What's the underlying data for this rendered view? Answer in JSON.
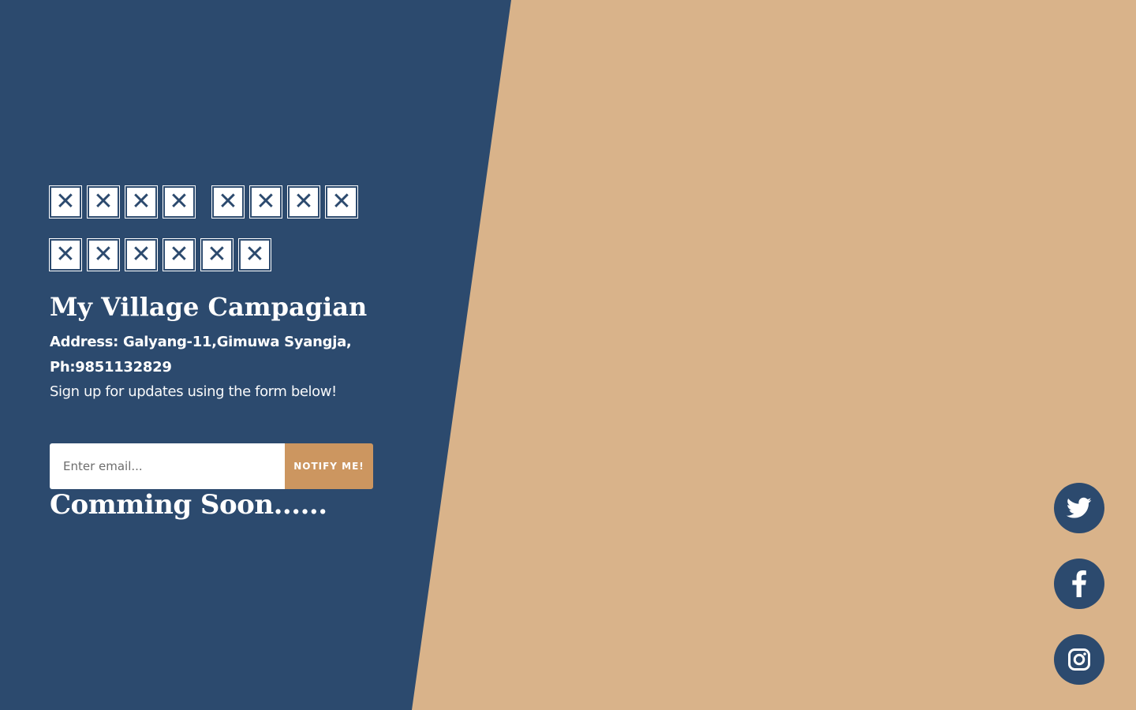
{
  "colors": {
    "navy": "#2c4a6e",
    "tan": "#d9b38a",
    "button": "#cc9660",
    "text": "#ffffff"
  },
  "header": {
    "placeholder_glyph": "✕"
  },
  "title": "My Village Campagian",
  "address": "Address: Galyang-11,Gimuwa Syangja,",
  "phone": "Ph:9851132829",
  "signup_text": "Sign up for updates using the form below!",
  "form": {
    "email_placeholder": "Enter email...",
    "notify_label": "NOTIFY ME!"
  },
  "coming_soon": "Comming Soon......",
  "social": {
    "icons": [
      "twitter-icon",
      "facebook-icon",
      "instagram-icon"
    ]
  }
}
